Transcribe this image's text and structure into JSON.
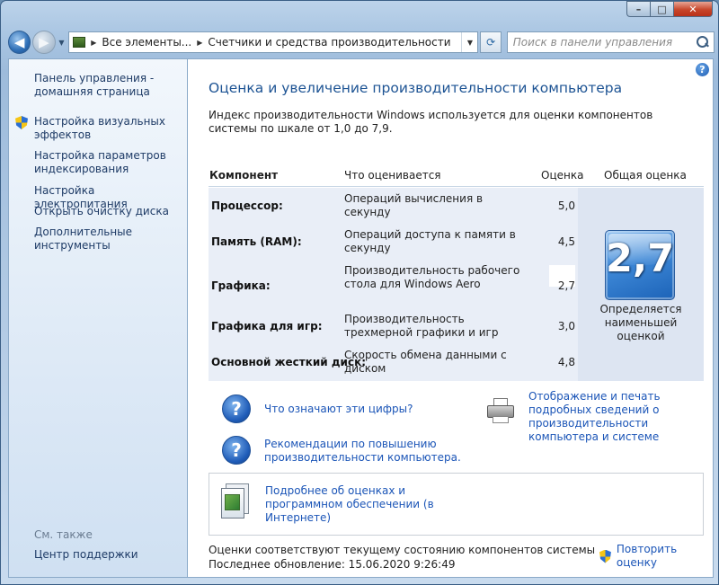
{
  "window": {
    "controls": {
      "minimize": "–",
      "maximize": "□",
      "close": "✕"
    }
  },
  "nav": {
    "breadcrumb": [
      "Все элементы...",
      "Счетчики и средства производительности"
    ],
    "search_placeholder": "Поиск в панели управления"
  },
  "sidebar": {
    "home": "Панель управления - домашняя страница",
    "items": [
      {
        "label": "Настройка визуальных эффектов",
        "icon": "shield-icon"
      },
      {
        "label": "Настройка параметров индексирования"
      },
      {
        "label": "Настройка электропитания"
      },
      {
        "label": "Открыть очистку диска"
      },
      {
        "label": "Дополнительные инструменты"
      }
    ],
    "see_also": "См. также",
    "support": "Центр поддержки"
  },
  "main": {
    "title": "Оценка и увеличение производительности компьютера",
    "intro": "Индекс производительности Windows используется для оценки компонентов системы по шкале от 1,0 до 7,9.",
    "columns": [
      "Компонент",
      "Что оценивается",
      "Оценка",
      "Общая оценка"
    ],
    "rows": [
      {
        "component": "Процессор:",
        "what": "Операций вычисления в секунду",
        "score": "5,0"
      },
      {
        "component": "Память (RAM):",
        "what": "Операций доступа к памяти в секунду",
        "score": "4,5"
      },
      {
        "component": "Графика:",
        "what": "Производительность рабочего стола для Windows Aero",
        "score": "2,7"
      },
      {
        "component": "Графика для игр:",
        "what": "Производительность трехмерной графики и игр",
        "score": "3,0"
      },
      {
        "component": "Основной жесткий диск:",
        "what": "Скорость обмена данными с диском",
        "score": "4,8"
      }
    ],
    "base_score": "2,7",
    "base_caption": "Определяется наименьшей оценкой",
    "links": {
      "what_numbers": "Что означают эти цифры?",
      "tips": "Рекомендации по повышению производительности компьютера.",
      "print_details": "Отображение и печать подробных сведений о производительности компьютера и системе",
      "online": "Подробнее об оценках и программном обеспечении (в Интернете)"
    },
    "status_line": "Оценки соответствуют текущему состоянию компонентов системы",
    "last_update": "Последнее обновление: 15.06.2020 9:26:49",
    "rerun": "Повторить оценку"
  },
  "colors": {
    "link": "#1b55b7",
    "title": "#1e5494",
    "badge": "#3d87d6",
    "table_bg": "#e9eef7"
  }
}
